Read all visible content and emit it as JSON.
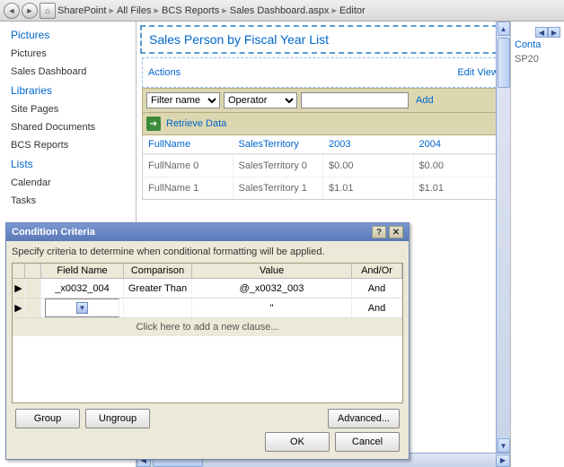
{
  "toolbar": {
    "breadcrumb": [
      "SharePoint",
      "All Files",
      "BCS Reports",
      "Sales Dashboard.aspx",
      "Editor"
    ]
  },
  "left": {
    "sections": [
      {
        "header": "Pictures",
        "items": [
          "Pictures",
          "Sales Dashboard"
        ]
      },
      {
        "header": "Libraries",
        "items": [
          "Site Pages",
          "Shared Documents",
          "BCS Reports"
        ]
      },
      {
        "header": "Lists",
        "items": [
          "Calendar",
          "Tasks"
        ]
      }
    ]
  },
  "webpart": {
    "title": "Sales Person by Fiscal Year List",
    "actions_label": "Actions",
    "editview_label": "Edit View",
    "filter_name": "Filter name",
    "operator": "Operator",
    "add": "Add",
    "retrieve": "Retrieve Data",
    "columns": [
      "FullName",
      "SalesTerritory",
      "2003",
      "2004"
    ],
    "rows": [
      [
        "FullName 0",
        "SalesTerritory 0",
        "$0.00",
        "$0.00"
      ],
      [
        "FullName 1",
        "SalesTerritory 1",
        "$1.01",
        "$1.01"
      ]
    ],
    "img_tooltip": "img"
  },
  "right": {
    "link": "Conta",
    "line2": "SP20"
  },
  "lights": {
    "rows": [
      [
        "r",
        "g",
        "y"
      ],
      [
        "r",
        "g",
        "y"
      ],
      [
        "r",
        "g",
        "y"
      ],
      [
        "r",
        "g",
        "y"
      ],
      [
        "r",
        "g",
        "y"
      ],
      [
        "r",
        "g",
        "y"
      ],
      [
        "r",
        "g",
        "y"
      ],
      [
        "r",
        "g",
        "y"
      ],
      [
        "r",
        "g",
        "y"
      ],
      [
        "r",
        "g",
        "y"
      ],
      [
        "r",
        "g",
        "y"
      ]
    ]
  },
  "dialog": {
    "title": "Condition Criteria",
    "hint": "Specify criteria to determine when conditional formatting will be applied.",
    "headers": {
      "field": "Field Name",
      "comp": "Comparison",
      "value": "Value",
      "andor": "And/Or"
    },
    "rows": [
      {
        "field": "_x0032_004",
        "comp": "Greater Than",
        "value": "@_x0032_003",
        "andor": "And"
      },
      {
        "field": "",
        "comp": "",
        "value": "''",
        "andor": "And"
      }
    ],
    "addclause": "Click here to add a new clause...",
    "buttons": {
      "group": "Group",
      "ungroup": "Ungroup",
      "advanced": "Advanced...",
      "ok": "OK",
      "cancel": "Cancel"
    }
  }
}
